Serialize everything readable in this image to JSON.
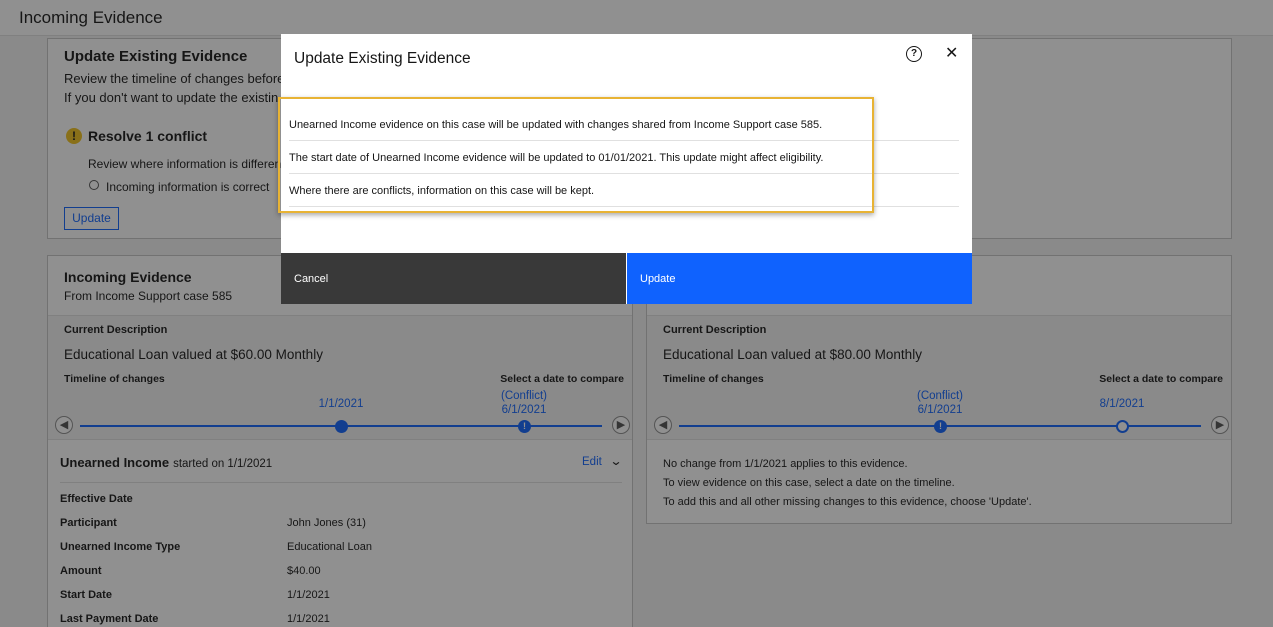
{
  "page": {
    "title": "Incoming Evidence"
  },
  "update_panel": {
    "title": "Update Existing Evidence",
    "line1": "Review the timeline of changes before",
    "line2": "If you don't want to update the existin",
    "conflict_title": "Resolve 1 conflict",
    "review_text": "Review where information is differen",
    "radio_label": "Incoming information is correct",
    "update_label": "Update"
  },
  "incoming_panel": {
    "title": "Incoming Evidence",
    "subtitle": "From Income Support case 585",
    "current_description_label": "Current Description",
    "current_description": "Educational Loan valued at $60.00 Monthly",
    "timeline_label": "Timeline of changes",
    "compare_label": "Select a date to compare",
    "timeline_points": [
      {
        "date": "1/1/2021",
        "conflict": ""
      },
      {
        "date": "6/1/2021",
        "conflict": "(Conflict)"
      }
    ],
    "section_title": "Unearned Income",
    "section_started": "started on 1/1/2021",
    "edit_label": "Edit",
    "fields": [
      {
        "label": "Effective Date",
        "value": ""
      },
      {
        "label": "Participant",
        "value": "John Jones (31)"
      },
      {
        "label": "Unearned Income Type",
        "value": "Educational Loan"
      },
      {
        "label": "Amount",
        "value": "$40.00"
      },
      {
        "label": "Start Date",
        "value": "1/1/2021"
      },
      {
        "label": "Last Payment Date",
        "value": "1/1/2021"
      }
    ]
  },
  "existing_panel": {
    "current_description_label": "Current Description",
    "current_description": "Educational Loan valued at $80.00 Monthly",
    "timeline_label": "Timeline of changes",
    "compare_label": "Select a date to compare",
    "timeline_points": [
      {
        "date": "6/1/2021",
        "conflict": "(Conflict)"
      },
      {
        "date": "8/1/2021",
        "conflict": ""
      }
    ],
    "messages": [
      "No change from 1/1/2021 applies to this evidence.",
      "To view evidence on this case, select a date on the timeline.",
      "To add this and all other missing changes to this evidence, choose 'Update'."
    ]
  },
  "modal": {
    "title": "Update Existing Evidence",
    "rows": [
      "Unearned Income evidence on this case will be updated with changes shared from Income Support case 585.",
      "The start date of Unearned Income evidence will be updated to 01/01/2021. This update might affect eligibility.",
      "Where there are conflicts, information on this case will be kept."
    ],
    "cancel_label": "Cancel",
    "update_label": "Update"
  },
  "icons": {
    "help": "help-icon",
    "close": "close-icon",
    "warning": "warning-icon",
    "conflict": "conflict-icon",
    "chevron": "chevron-down-icon"
  },
  "colors": {
    "primary": "#0f62fe",
    "warning": "#f1c21b",
    "highlight": "#e8b334",
    "cancel_button": "#393939"
  }
}
